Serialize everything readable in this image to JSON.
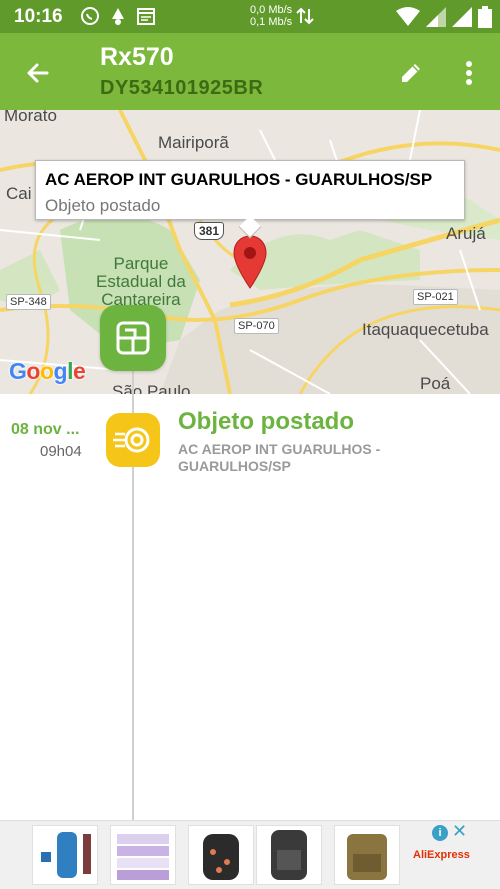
{
  "status_bar": {
    "time": "10:16",
    "net_up": "0,0 Mb/s",
    "net_down": "0,1 Mb/s"
  },
  "app_bar": {
    "title": "Rx570",
    "tracking_code": "DY534101925BR"
  },
  "map": {
    "places": [
      "Morato",
      "Mairiporã",
      "Cai",
      "Arujá",
      "Itaquaquecetuba",
      "Poá",
      "São Paulo"
    ],
    "park_label": [
      "Parque",
      "Estadual da",
      "Cantareira"
    ],
    "road_labels": [
      "SP-348",
      "SP-021",
      "SP-070"
    ],
    "route_shield": "381",
    "callout_title": "AC AEROP INT GUARULHOS - GUARULHOS/SP",
    "callout_subtitle": "Objeto postado",
    "attribution": "Google"
  },
  "events": [
    {
      "date": "08 nov ...",
      "time": "09h04",
      "status": "Objeto postado",
      "location": "AC AEROP INT GUARULHOS - GUARULHOS/SP"
    }
  ],
  "ad": {
    "brand": "AliExpress",
    "adchoices": "i",
    "close": "✕"
  },
  "colors": {
    "status_bar": "#5f9a2a",
    "app_bar": "#7cb83b",
    "accent_green": "#6cb33f",
    "event_icon": "#f5c518",
    "pin": "#e53935"
  },
  "icons": [
    "back-arrow-icon",
    "edit-pencil-icon",
    "more-vert-icon",
    "package-box-icon",
    "posted-signal-icon",
    "map-pin-icon"
  ]
}
